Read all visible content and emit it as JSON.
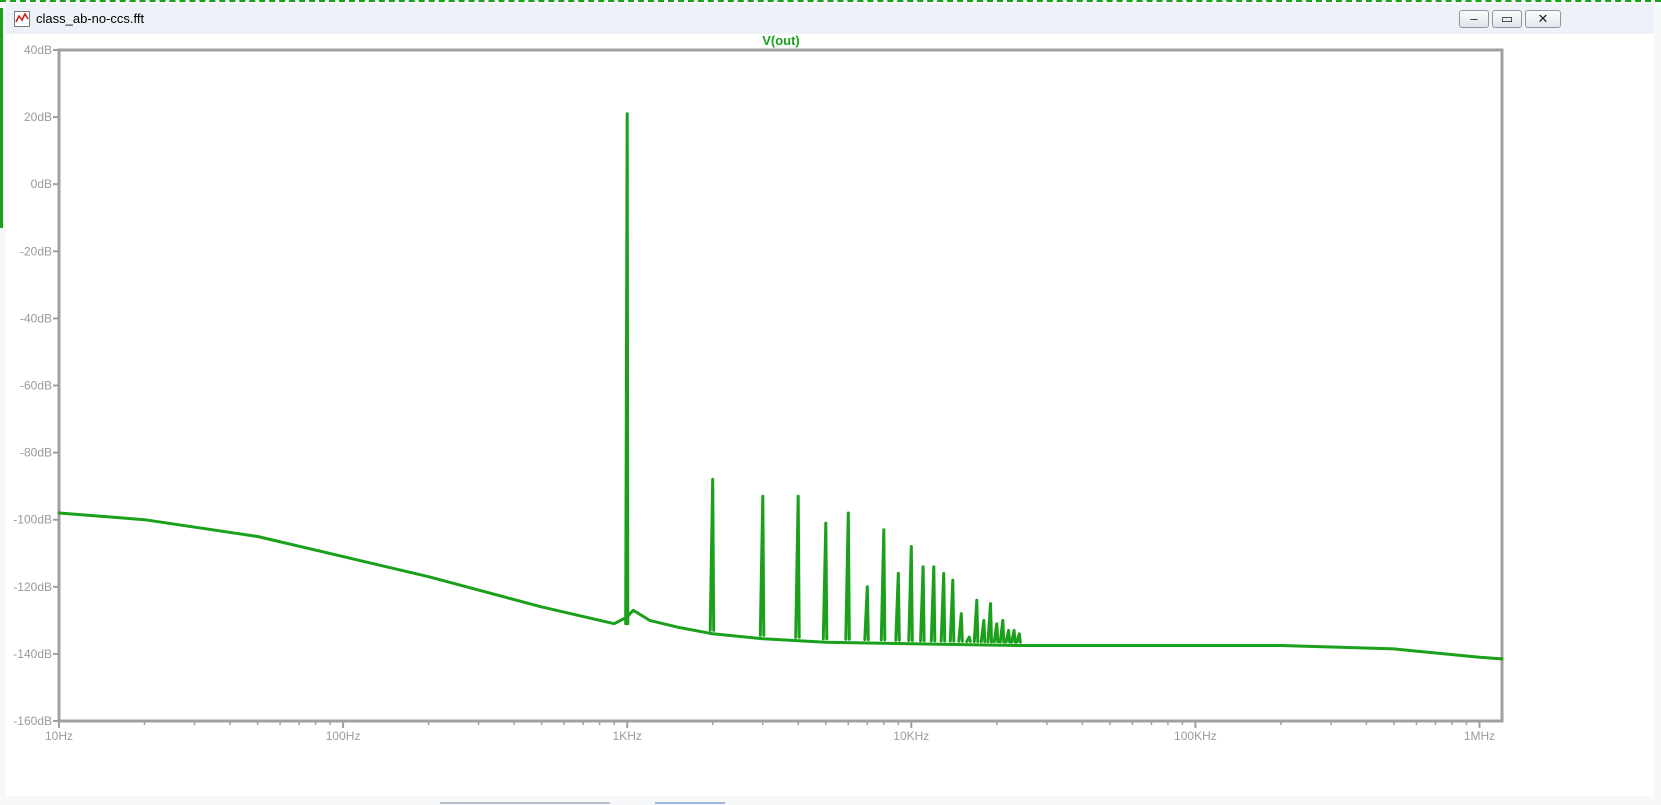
{
  "window": {
    "title": "class_ab-no-ccs.fft",
    "icon": "waveform-plot-icon",
    "buttons": {
      "minimize": "–",
      "restore": "▭",
      "close": "✕"
    }
  },
  "colors": {
    "trace": "#1aa01a",
    "axis": "#a0a0a0",
    "tick_label": "#9a9a9a",
    "background": "#ffffff"
  },
  "chart_data": {
    "type": "line",
    "title": "V(out)",
    "xscale": "log",
    "xlabel": "",
    "ylabel": "",
    "xlim": [
      10,
      1200000
    ],
    "ylim": [
      -160,
      40
    ],
    "grid": false,
    "x_ticks": [
      {
        "value": 10,
        "label": "10Hz"
      },
      {
        "value": 100,
        "label": "100Hz"
      },
      {
        "value": 1000,
        "label": "1KHz"
      },
      {
        "value": 10000,
        "label": "10KHz"
      },
      {
        "value": 100000,
        "label": "100KHz"
      },
      {
        "value": 1000000,
        "label": "1MHz"
      }
    ],
    "y_ticks": [
      {
        "value": 40,
        "label": "40dB"
      },
      {
        "value": 20,
        "label": "20dB"
      },
      {
        "value": 0,
        "label": "0dB"
      },
      {
        "value": -20,
        "label": "-20dB"
      },
      {
        "value": -40,
        "label": "-40dB"
      },
      {
        "value": -60,
        "label": "-60dB"
      },
      {
        "value": -80,
        "label": "-80dB"
      },
      {
        "value": -100,
        "label": "-100dB"
      },
      {
        "value": -120,
        "label": "-120dB"
      },
      {
        "value": -140,
        "label": "-140dB"
      },
      {
        "value": -160,
        "label": "-160dB"
      }
    ],
    "series": [
      {
        "name": "V(out)",
        "noise_floor": {
          "x": [
            10,
            20,
            50,
            100,
            200,
            500,
            900,
            1000
          ],
          "y": [
            -98,
            -100,
            -105,
            -111,
            -117,
            -126,
            -131,
            -129
          ]
        },
        "floor_after_fundamental": {
          "x": [
            1050,
            1200,
            1500,
            2000,
            3000,
            5000,
            10000,
            24000,
            50000,
            100000,
            200000,
            500000,
            1000000,
            1200000
          ],
          "y": [
            -127,
            -130,
            -132,
            -134,
            -135.5,
            -136.5,
            -137,
            -137.5,
            -137.5,
            -137.5,
            -137.5,
            -138.5,
            -141,
            -141.5
          ]
        },
        "peaks": {
          "x": [
            1000,
            2000,
            3000,
            4000,
            5000,
            6000,
            7000,
            8000,
            9000,
            10000,
            11000,
            12000,
            13000,
            14000,
            15000,
            16000,
            17000,
            18000,
            19000,
            20000,
            21000,
            22000,
            23000,
            24000
          ],
          "y": [
            21,
            -88,
            -93,
            -93,
            -101,
            -98,
            -120,
            -103,
            -116,
            -108,
            -114,
            -114,
            -116,
            -118,
            -128,
            -135,
            -124,
            -130,
            -125,
            -131,
            -130,
            -133,
            -133,
            -134
          ]
        }
      }
    ]
  }
}
